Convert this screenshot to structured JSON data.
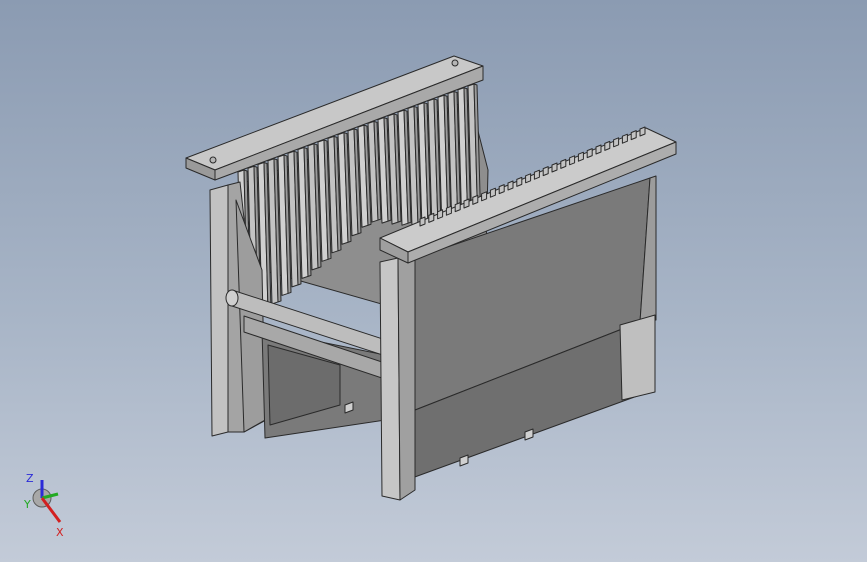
{
  "viewport": {
    "background_top": "#8b9bb2",
    "background_bottom": "#c3cbd8"
  },
  "model": {
    "part": "wafer-carrier",
    "rib_count_back": 24,
    "slot_count_front": 26,
    "colors": {
      "light_face": "#c3c3c3",
      "mid_face": "#9b9b9b",
      "dark_face": "#7c7c7c",
      "edge": "#2a2a2a"
    }
  },
  "triad": {
    "z_label": "Z",
    "y_label": "Y",
    "x_label": "X",
    "z_color": "#2b2bd8",
    "y_color": "#22aa22",
    "x_color": "#d22020"
  }
}
